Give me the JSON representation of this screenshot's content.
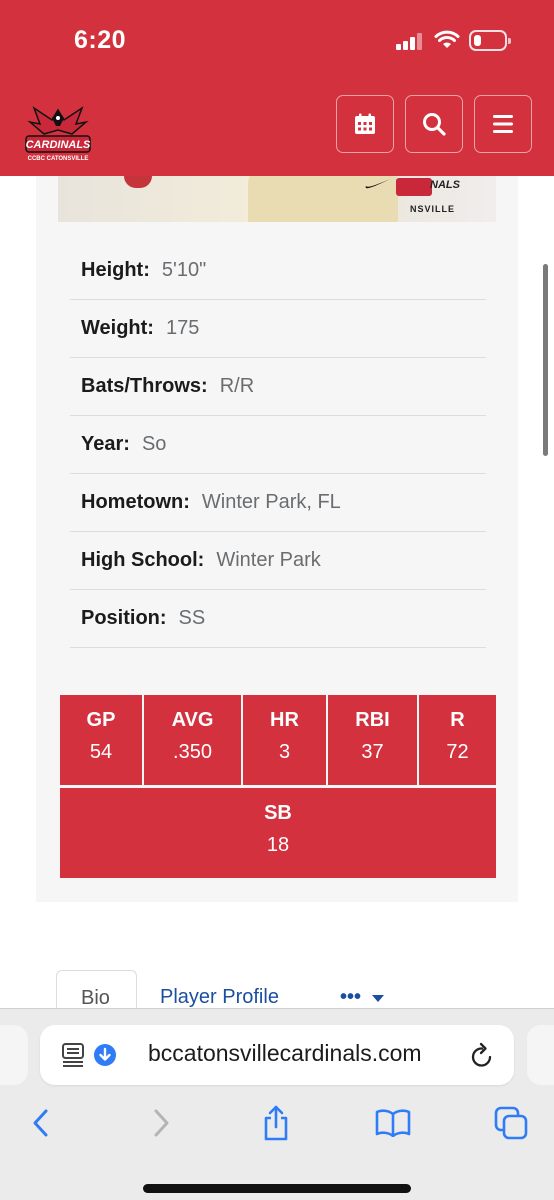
{
  "status": {
    "time": "6:20"
  },
  "header": {
    "logo_text": "CARDINALS",
    "logo_subtext": "CCBC CATONSVILLE",
    "icons": [
      "calendar-icon",
      "search-icon",
      "menu-icon"
    ]
  },
  "photo": {
    "caption": "NALS",
    "subcaption": "NSVILLE"
  },
  "player_info": [
    {
      "label": "Height:",
      "value": "5'10\""
    },
    {
      "label": "Weight:",
      "value": "175"
    },
    {
      "label": "Bats/Throws:",
      "value": "R/R"
    },
    {
      "label": "Year:",
      "value": "So"
    },
    {
      "label": "Hometown:",
      "value": "Winter Park, FL"
    },
    {
      "label": "High School:",
      "value": "Winter Park"
    },
    {
      "label": "Position:",
      "value": "SS"
    }
  ],
  "stats": [
    {
      "label": "GP",
      "value": "54"
    },
    {
      "label": "AVG",
      "value": ".350"
    },
    {
      "label": "HR",
      "value": "3"
    },
    {
      "label": "RBI",
      "value": "37"
    },
    {
      "label": "R",
      "value": "72"
    },
    {
      "label": "SB",
      "value": "18"
    }
  ],
  "tabs": {
    "bio": "Bio",
    "profile": "Player Profile",
    "more": "•••"
  },
  "browser": {
    "url": "bccatonsvillecardinals.com"
  },
  "colors": {
    "brand": "#d3313e",
    "link": "#1b4fa0",
    "safari_blue": "#2f7cf6"
  }
}
